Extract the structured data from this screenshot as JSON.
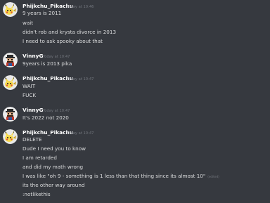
{
  "groups": [
    {
      "username": "Phijkchu_Pikachu",
      "timestamp": "Today at 10:46",
      "lines": [
        "9 years is 2011",
        "wait",
        "didn't rob and krysta divorce in 2013",
        "I need to ask spooky about that"
      ]
    },
    {
      "username": "VinnyG",
      "timestamp": "Today at 10:47",
      "lines": [
        "9years is 2013 pika"
      ]
    },
    {
      "username": "Phijkchu_Pikachu",
      "timestamp": "Today at 10:47",
      "lines": [
        "WAIT",
        "FUCK"
      ]
    },
    {
      "username": "VinnyG",
      "timestamp": "Today at 10:47",
      "lines": [
        "It's 2022 not 2020"
      ]
    },
    {
      "username": "Phijkchu_Pikachu",
      "timestamp": "Today at 10:47",
      "lines": [
        "DELETE",
        "Dude I need you to know",
        "I am retarded",
        "and did my math wrong",
        "I was like \"oh 9 - something is 1 less than that thing since its almost 10\"",
        "its the other way around",
        ":notlikethis"
      ],
      "edited_label": "(edited)"
    }
  ],
  "colors": {
    "background": "#36393f",
    "username": "#ffffff",
    "text": "#dcddde",
    "muted": "#72767d"
  },
  "icons": {
    "pikachu_avatar": "pikachu-avatar-icon",
    "vinny_avatar": "mario-avatar-icon"
  }
}
